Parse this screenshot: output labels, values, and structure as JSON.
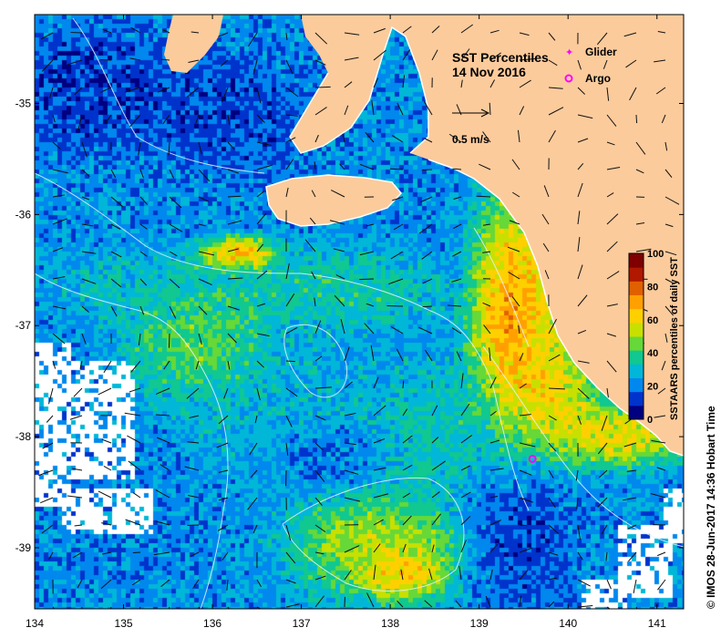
{
  "map": {
    "title_line1": "SST Percentiles",
    "title_line2": "14 Nov 2016",
    "legend": {
      "glider_label": "Glider",
      "argo_label": "Argo",
      "glider_color": "#ff00ff",
      "argo_color": "#ff00ff"
    },
    "vector_scale_label": "0.5 m/s",
    "credit": "© IMOS 28-Jun-2017 14:36 Hobart Time",
    "colorbar": {
      "label": "SSTAARS percentiles of daily SST",
      "ticks": [
        "0",
        "20",
        "40",
        "60",
        "80",
        "100"
      ],
      "range": [
        0,
        100
      ],
      "colors": [
        "#000080",
        "#0033cc",
        "#0088ee",
        "#00b7d8",
        "#10c890",
        "#66d838",
        "#c8e000",
        "#ffd000",
        "#ffa000",
        "#e06000",
        "#b01800",
        "#800000"
      ]
    },
    "axes": {
      "x_ticks": [
        "134",
        "135",
        "136",
        "137",
        "138",
        "139",
        "140",
        "141"
      ],
      "y_ticks": [
        "-35",
        "-36",
        "-37",
        "-38",
        "-39"
      ],
      "lon_range": [
        134,
        141.3
      ],
      "lat_range": [
        -34.2,
        -39.55
      ]
    },
    "colors": {
      "land": "#fccb9c",
      "missing": "#ffffff",
      "coast": "#ffffff"
    },
    "argo_position": {
      "lon": 139.6,
      "lat": -38.2
    }
  }
}
